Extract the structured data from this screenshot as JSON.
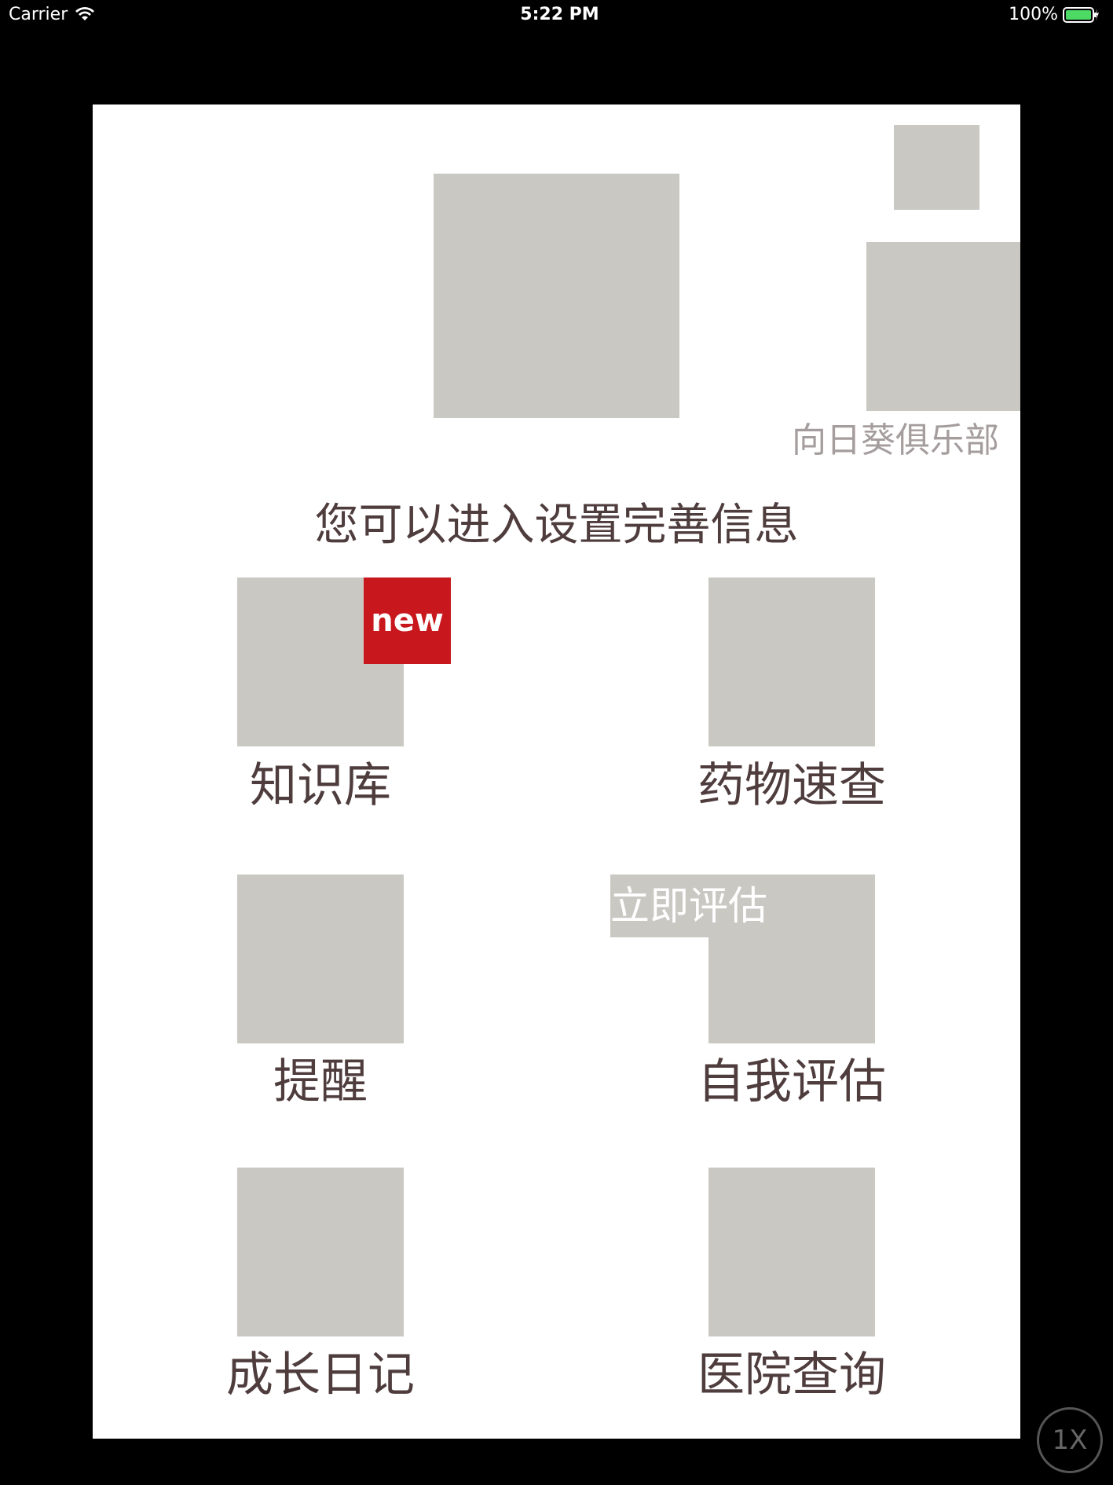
{
  "status_bar": {
    "carrier": "Carrier",
    "time": "5:22 PM",
    "battery_percent": "100%",
    "battery_color": "#4cd964",
    "wifi_icon": "wifi-icon",
    "battery_icon": "battery-charging-icon"
  },
  "header": {
    "club_label": "向日葵俱乐部",
    "setup_hint": "您可以进入设置完善信息"
  },
  "menu": {
    "items": [
      {
        "label": "知识库",
        "badge": "new",
        "badge_color": "#c8171d"
      },
      {
        "label": "药物速查"
      },
      {
        "label": "提醒"
      },
      {
        "label": "自我评估",
        "badge": "立即评估"
      },
      {
        "label": "成长日记"
      },
      {
        "label": "医院查询"
      }
    ]
  },
  "zoom_button": {
    "label": "1X"
  },
  "colors": {
    "placeholder": "#c9c8c3",
    "text": "#4f3d3e",
    "club_text": "#a59d9d"
  }
}
